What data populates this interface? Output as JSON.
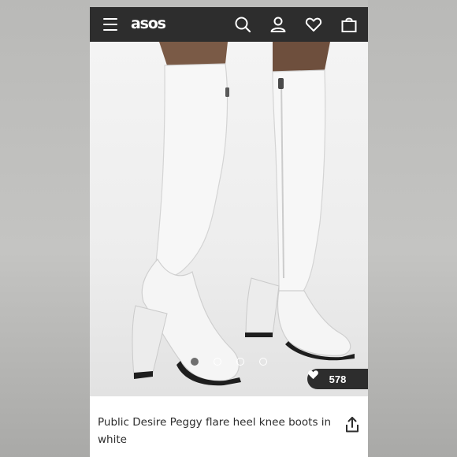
{
  "header": {
    "logo_text": "asos",
    "icons": [
      "menu-icon",
      "search-icon",
      "account-icon",
      "wishlist-icon",
      "bag-icon"
    ],
    "background_color": "#2d2d2d"
  },
  "gallery": {
    "image_count": 4,
    "active_index": 0,
    "like_count": "578"
  },
  "product": {
    "title": "Public Desire Peggy flare heel knee boots in white"
  }
}
